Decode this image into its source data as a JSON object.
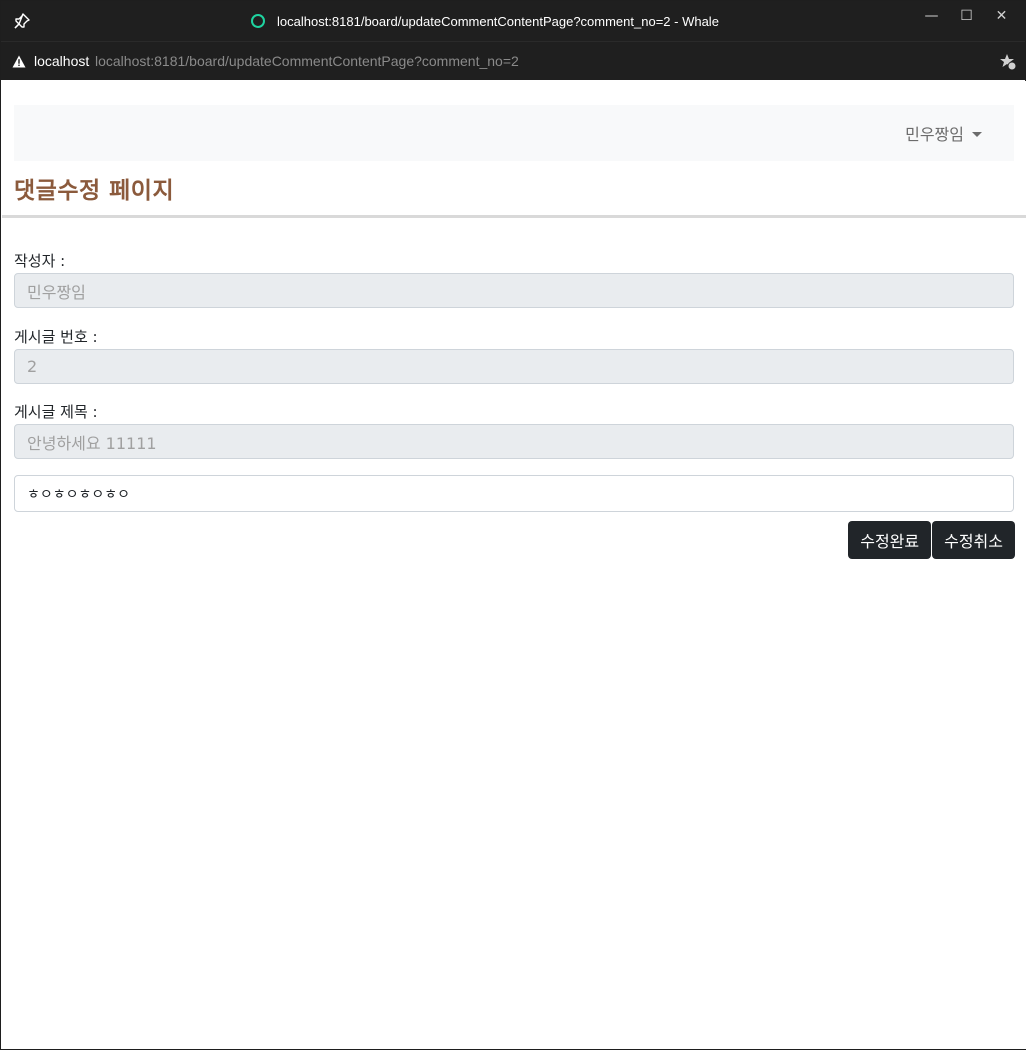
{
  "browser": {
    "window_title": "localhost:8181/board/updateCommentContentPage?comment_no=2 - Whale",
    "host": "localhost",
    "url": "localhost:8181/board/updateCommentContentPage?comment_no=2",
    "controls": {
      "minimize": "—",
      "maximize": "☐",
      "close": "✕"
    }
  },
  "navbar": {
    "user_name": "민우짱임"
  },
  "page": {
    "title": "댓글수정 페이지"
  },
  "form": {
    "writer_label": "작성자 :",
    "writer_value": "민우짱임",
    "post_no_label": "게시글 번호 :",
    "post_no_value": "2",
    "post_title_label": "게시글 제목 :",
    "post_title_value": "안녕하세요 11111",
    "comment_value": "ㅎㅇㅎㅇㅎㅇㅎㅇ"
  },
  "buttons": {
    "submit": "수정완료",
    "cancel": "수정취소"
  },
  "colors": {
    "title": "#8b5a3c",
    "button": "#212529",
    "chrome": "#1f1f1f",
    "loading": "#1ed3a0"
  }
}
